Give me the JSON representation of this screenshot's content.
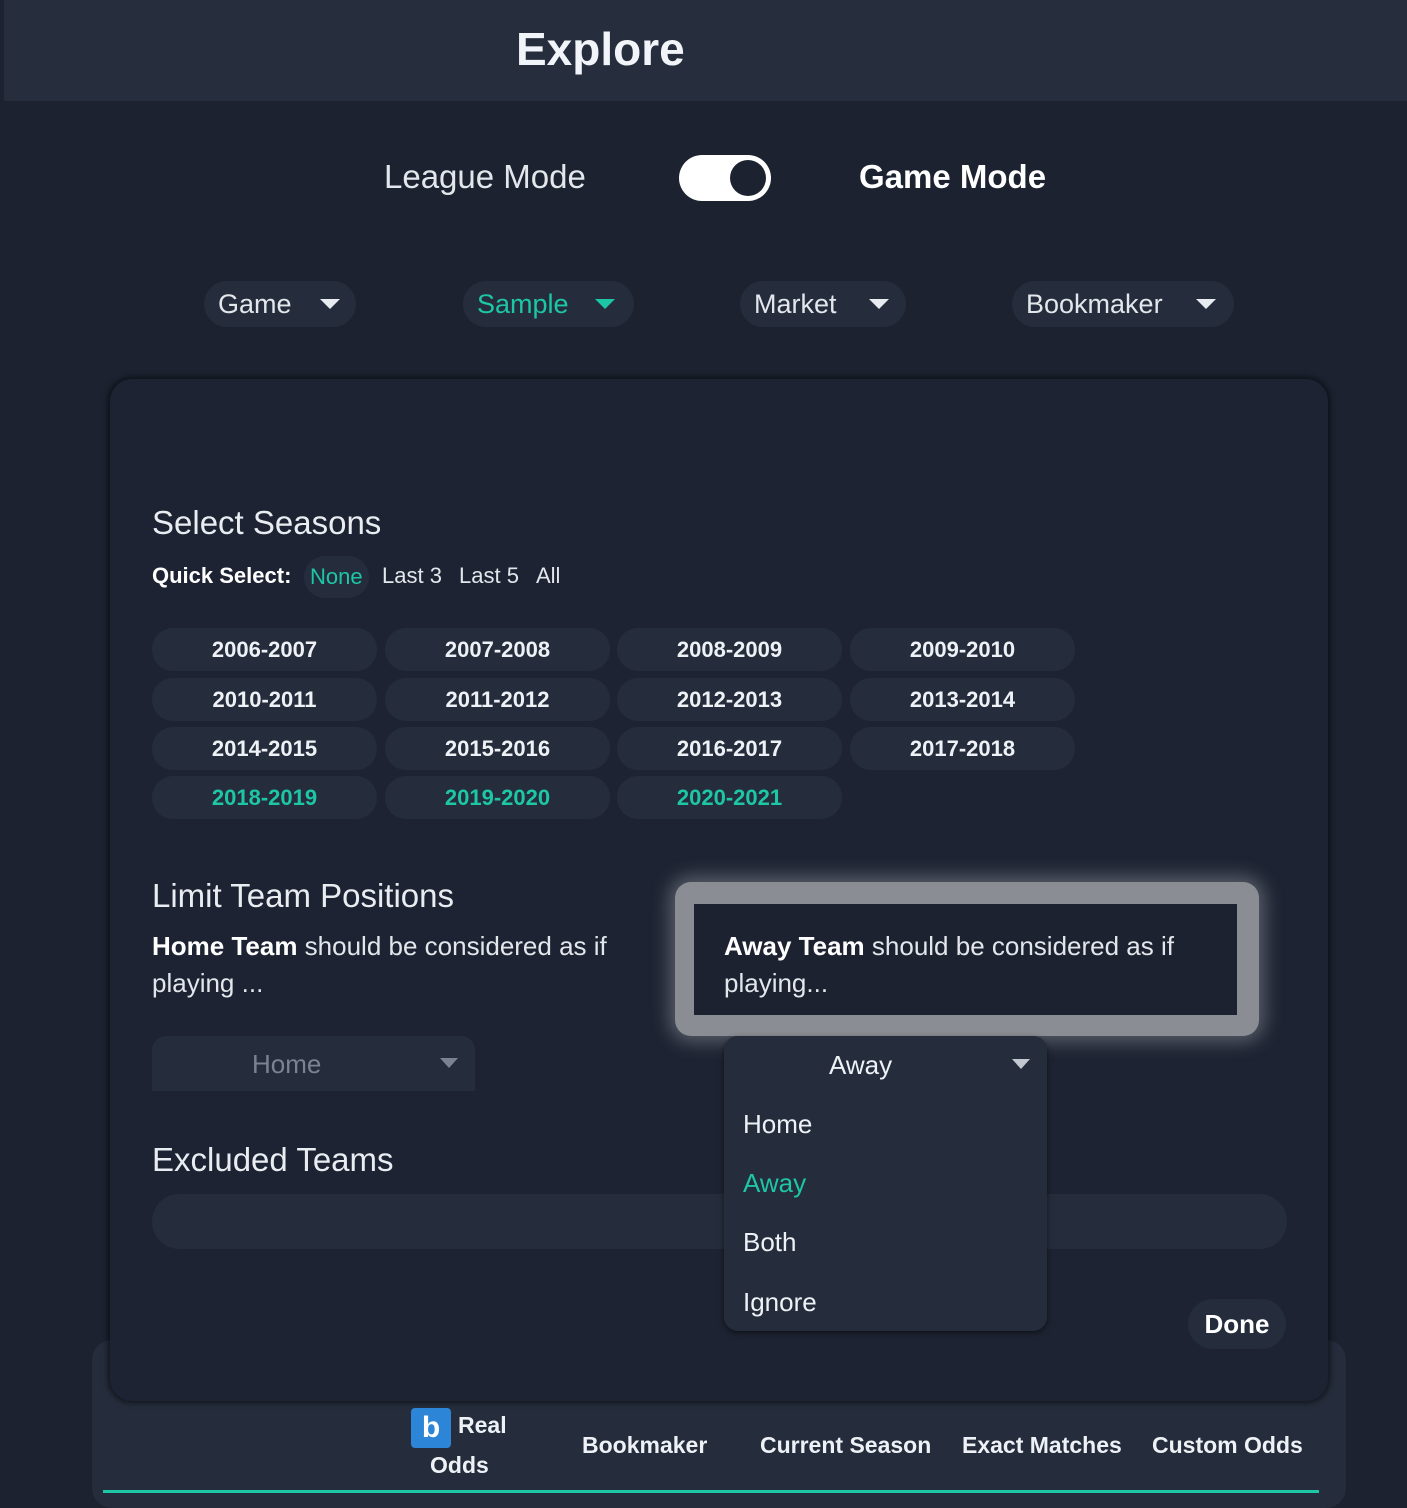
{
  "header": {
    "title": "Explore"
  },
  "mode_toggle": {
    "left_label": "League Mode",
    "right_label": "Game Mode",
    "state": "on"
  },
  "filters": [
    {
      "label": "Game",
      "active": false
    },
    {
      "label": "Sample",
      "active": true
    },
    {
      "label": "Market",
      "active": false
    },
    {
      "label": "Bookmaker",
      "active": false
    }
  ],
  "seasons": {
    "title": "Select Seasons",
    "quick_select": {
      "label": "Quick Select:",
      "options": [
        "None",
        "Last 3",
        "Last 5",
        "All"
      ],
      "selected": "None"
    },
    "items": [
      {
        "label": "2006-2007",
        "selected": false
      },
      {
        "label": "2007-2008",
        "selected": false
      },
      {
        "label": "2008-2009",
        "selected": false
      },
      {
        "label": "2009-2010",
        "selected": false
      },
      {
        "label": "2010-2011",
        "selected": false
      },
      {
        "label": "2011-2012",
        "selected": false
      },
      {
        "label": "2012-2013",
        "selected": false
      },
      {
        "label": "2013-2014",
        "selected": false
      },
      {
        "label": "2014-2015",
        "selected": false
      },
      {
        "label": "2015-2016",
        "selected": false
      },
      {
        "label": "2016-2017",
        "selected": false
      },
      {
        "label": "2017-2018",
        "selected": false
      },
      {
        "label": "2018-2019",
        "selected": true
      },
      {
        "label": "2019-2020",
        "selected": true
      },
      {
        "label": "2020-2021",
        "selected": true
      }
    ]
  },
  "positions": {
    "title": "Limit Team Positions",
    "home_desc_bold": "Home Team",
    "home_desc_rest": " should be considered as if playing ...",
    "away_desc_bold": "Away Team",
    "away_desc_rest": " should be considered as if playing...",
    "home_select_value": "Home",
    "away_select_value": "Away",
    "away_options": [
      "Home",
      "Away",
      "Both",
      "Ignore"
    ],
    "away_selected_option": "Away"
  },
  "excluded": {
    "title": "Excluded Teams"
  },
  "done_label": "Done",
  "table_header": {
    "real_odds_line1": "Real",
    "real_odds_line2": "Odds",
    "real_icon_glyph": "b",
    "columns": [
      "Bookmaker",
      "Current Season",
      "Exact Matches",
      "Custom Odds"
    ]
  },
  "colors": {
    "accent": "#1dc6a4",
    "background": "#1c2230",
    "surface": "#252d3c",
    "icon_blue": "#2c85d6"
  }
}
